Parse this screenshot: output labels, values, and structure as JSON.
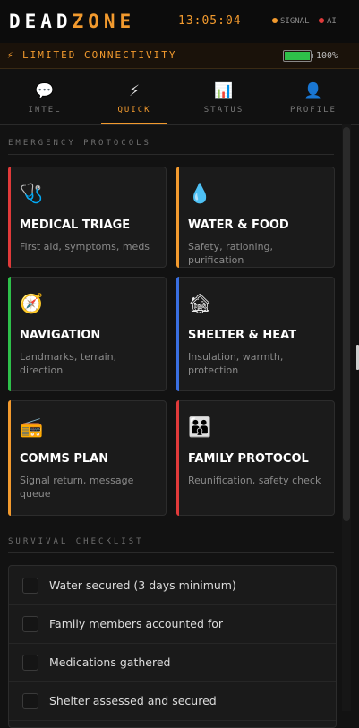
{
  "app": {
    "logo_part1": "DEAD",
    "logo_part2": "ZONE",
    "clock": "13:05:04"
  },
  "indicators": [
    {
      "label": "SIGNAL",
      "color": "#f29a2e"
    },
    {
      "label": "AI",
      "color": "#e03a3a"
    }
  ],
  "banner": {
    "icon": "⚡",
    "text": "LIMITED CONNECTIVITY",
    "battery_percent": "100%",
    "battery_level": 1.0,
    "battery_color": "#2ec04a"
  },
  "tabs": [
    {
      "label": "INTEL",
      "icon": "💬",
      "icon_name": "chat-icon"
    },
    {
      "label": "QUICK",
      "icon": "⚡",
      "icon_name": "bolt-icon",
      "active": true
    },
    {
      "label": "STATUS",
      "icon": "📊",
      "icon_name": "chart-icon"
    },
    {
      "label": "PROFILE",
      "icon": "👤",
      "icon_name": "profile-icon"
    }
  ],
  "sections": {
    "protocols": "EMERGENCY PROTOCOLS",
    "checklist": "SURVIVAL CHECKLIST"
  },
  "cards": [
    {
      "title": "MEDICAL TRIAGE",
      "desc": "First aid, symptoms, meds",
      "icon": "🩺",
      "icon_name": "stethoscope-icon",
      "accent": "#e03a3a"
    },
    {
      "title": "WATER & FOOD",
      "desc": "Safety, rationing, purification",
      "icon": "💧",
      "icon_name": "water-drop-icon",
      "accent": "#f29a2e"
    },
    {
      "title": "NAVIGATION",
      "desc": "Landmarks, terrain, direction",
      "icon": "🧭",
      "icon_name": "compass-icon",
      "accent": "#2ec04a"
    },
    {
      "title": "SHELTER & HEAT",
      "desc": "Insulation, warmth, protection",
      "icon": "🏚",
      "icon_name": "house-icon",
      "accent": "#3a6fe0"
    },
    {
      "title": "COMMS PLAN",
      "desc": "Signal return, message queue",
      "icon": "📻",
      "icon_name": "radio-icon",
      "accent": "#f29a2e"
    },
    {
      "title": "FAMILY PROTOCOL",
      "desc": "Reunification, safety check",
      "icon": "👪",
      "icon_name": "family-icon",
      "accent": "#e03a3a"
    }
  ],
  "checklist": [
    {
      "text": "Water secured (3 days minimum)",
      "checked": false
    },
    {
      "text": "Family members accounted for",
      "checked": false
    },
    {
      "text": "Medications gathered",
      "checked": false
    },
    {
      "text": "Shelter assessed and secured",
      "checked": false
    }
  ]
}
